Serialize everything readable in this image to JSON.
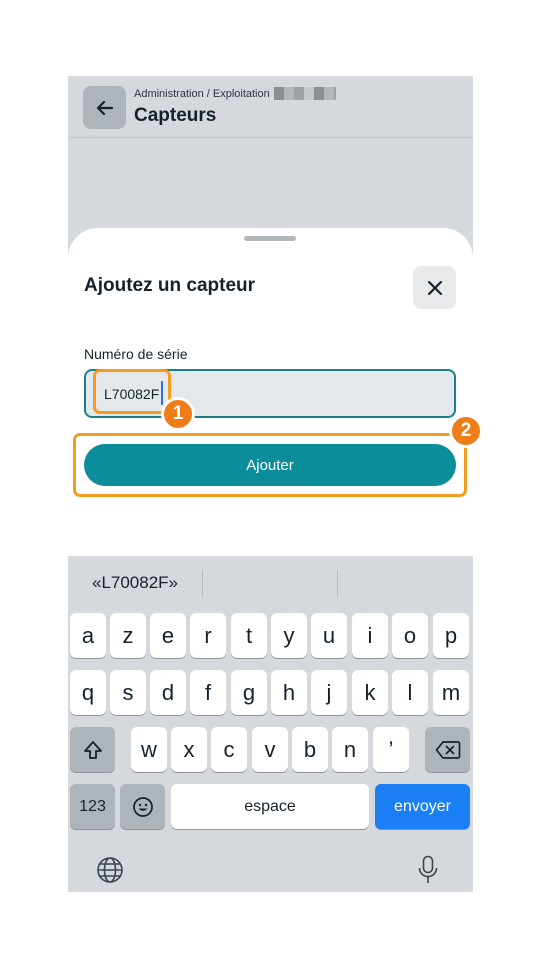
{
  "header": {
    "breadcrumb": "Administration / Exploitation",
    "title": "Capteurs"
  },
  "sheet": {
    "title": "Ajoutez un capteur",
    "field_label": "Numéro de série",
    "input_value": "L70082F",
    "submit_label": "Ajouter"
  },
  "annotations": {
    "step1": "1",
    "step2": "2",
    "color": "#f39c1f"
  },
  "keyboard": {
    "suggestion": "«L70082F»",
    "row1": [
      "a",
      "z",
      "e",
      "r",
      "t",
      "y",
      "u",
      "i",
      "o",
      "p"
    ],
    "row2": [
      "q",
      "s",
      "d",
      "f",
      "g",
      "h",
      "j",
      "k",
      "l",
      "m"
    ],
    "row3": [
      "w",
      "x",
      "c",
      "v",
      "b",
      "n",
      "’"
    ],
    "numbers_key": "123",
    "space_key": "espace",
    "send_key": "envoyer",
    "accent_color": "#1a7ef5"
  }
}
